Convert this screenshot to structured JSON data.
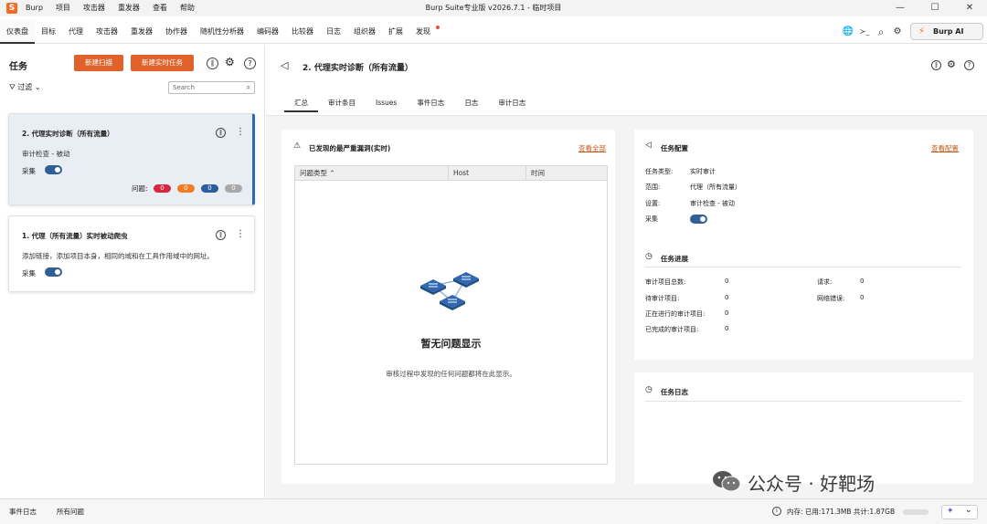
{
  "titlebar": {
    "logo": "S",
    "menu": [
      "Burp",
      "项目",
      "攻击器",
      "重发器",
      "查看",
      "帮助"
    ],
    "title": "Burp Suite专业版 v2026.7.1 - 临时项目",
    "minimize": "—",
    "maximize": "☐",
    "close": "✕"
  },
  "tabs": [
    {
      "label": "仪表盘",
      "active": true
    },
    {
      "label": "目标"
    },
    {
      "label": "代理"
    },
    {
      "label": "攻击器"
    },
    {
      "label": "重发器"
    },
    {
      "label": "协作器"
    },
    {
      "label": "随机性分析器"
    },
    {
      "label": "编码器"
    },
    {
      "label": "比较器"
    },
    {
      "label": "日志"
    },
    {
      "label": "组织器"
    },
    {
      "label": "扩展"
    },
    {
      "label": "发现",
      "notify": true
    }
  ],
  "toolbar": {
    "globe": "🌐",
    "terminal": "≻_",
    "search": "⌕",
    "settings": "⚙",
    "burp_ai": "Burp AI"
  },
  "tasks": {
    "title": "任务",
    "new_scan": "新建扫描",
    "new_live_task": "新建实时任务",
    "filter": "过滤",
    "search_placeholder": "Search",
    "cards": [
      {
        "title": "2. 代理实时诊断（所有流量）",
        "subtitle": "审计检查 - 被动",
        "collect": "采集",
        "issues_label": "问题:",
        "issues": [
          "0",
          "0",
          "0",
          "0"
        ],
        "selected": true
      },
      {
        "title": "1. 代理（所有流量）实时被动爬虫",
        "subtitle": "添加链接，添加项目本身，相同的域和在工具作用域中的网址。",
        "collect": "采集"
      }
    ]
  },
  "detail": {
    "title": "2. 代理实时诊断（所有流量）",
    "tabs": [
      "汇总",
      "审计条目",
      "Issues",
      "事件日志",
      "日志",
      "审计日志"
    ],
    "issues_panel": {
      "title": "已发现的最严重漏洞(实时)",
      "view_all": "查看全部",
      "columns": [
        "问题类型",
        "Host",
        "时间"
      ],
      "empty_title": "暂无问题显示",
      "empty_sub": "审核过程中发现的任何问题都将在此显示。"
    },
    "config_panel": {
      "title": "任务配置",
      "view_config": "查看配置",
      "rows": [
        {
          "label": "任务类型:",
          "value": "实时审计"
        },
        {
          "label": "范围:",
          "value": "代理（所有流量）"
        },
        {
          "label": "设置:",
          "value": "审计检查 - 被动"
        }
      ],
      "collect": "采集"
    },
    "progress_panel": {
      "title": "任务进展",
      "left": [
        {
          "label": "审计项目总数:",
          "value": "0"
        },
        {
          "label": "待审计项目:",
          "value": "0"
        },
        {
          "label": "正在进行的审计项目:",
          "value": "0"
        },
        {
          "label": "已完成的审计项目:",
          "value": "0"
        }
      ],
      "right": [
        {
          "label": "请求:",
          "value": "0"
        },
        {
          "label": "网络错误:",
          "value": "0"
        }
      ]
    },
    "log_panel": {
      "title": "任务日志"
    }
  },
  "statusbar": {
    "event_log": "事件日志",
    "all_issues": "所有问题",
    "memory": "内存: 已用:171.3MB 共计:1.87GB"
  },
  "watermark": "公众号 · 好靶场",
  "colors": {
    "accent": "#e0622a",
    "toggle": "#2f5f96",
    "badge_high": "#d7263d",
    "badge_medium": "#f07d25",
    "badge_low": "#2a5ea0",
    "badge_info": "#a9a9a9",
    "link": "#c25b19"
  }
}
